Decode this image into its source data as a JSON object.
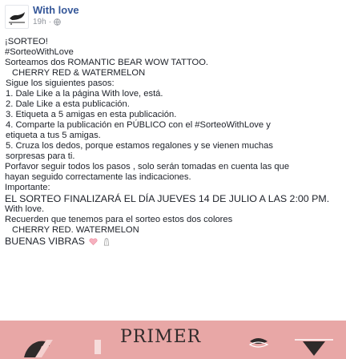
{
  "post": {
    "author": "With love",
    "time": "19h",
    "privacy_separator": "·",
    "lines": [
      "¡SORTEO!",
      "#SorteoWithLove",
      "Sorteamos dos ROMANTIC BEAR WOW TATTOO.",
      "  CHERRY RED & WATERMELON",
      "Sigue los siguientes pasos:",
      "1. Dale Like a la página With love, está.",
      "2. Dale Like a esta publicación.",
      "3. Etiqueta a 5 amigas en esta publicación.",
      "4. Comparte la publicación en PÚBLICO con el #SorteoWithLove y",
      "etiqueta a tus 5 amigas.",
      "5. Cruza los dedos, porque estamos regalones y se vienen muchas",
      "sorpresas para ti.",
      "Porfavor seguir todos los pasos , solo serán tomadas en cuenta las que",
      "hayan seguido correctamente las indicaciones.",
      "Importante:",
      "EL SORTEO FINALIZARÁ EL DÍA JUEVES 14 DE JULIO A LAS 2:00 PM.",
      "With love.",
      "Recuerden que tenemos para el sorteo estos dos colores",
      "  CHERRY RED. WATERMELON",
      "BUENAS VIBRAS"
    ]
  },
  "banner": {
    "title": "PRIMER",
    "bg_color": "#e8a7a6"
  },
  "colors": {
    "author": "#365899",
    "meta": "#90949c",
    "text": "#1d2129"
  }
}
